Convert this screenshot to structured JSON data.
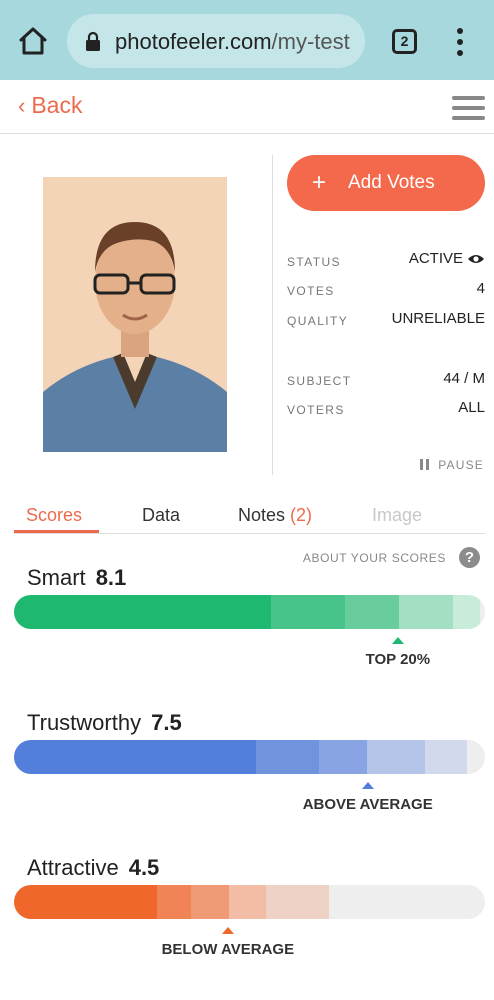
{
  "browser": {
    "url_main": "photofeeler.com",
    "url_path": "/my-test",
    "tab_count": "2"
  },
  "header": {
    "back_label": "Back"
  },
  "test": {
    "add_votes_label": "Add Votes",
    "info": [
      {
        "label": "STATUS",
        "value": "ACTIVE"
      },
      {
        "label": "VOTES",
        "value": "4"
      },
      {
        "label": "QUALITY",
        "value": "UNRELIABLE"
      },
      {
        "label": "SUBJECT",
        "value": "44 / M"
      },
      {
        "label": "VOTERS",
        "value": "ALL"
      }
    ],
    "pause_label": "PAUSE"
  },
  "tabs": [
    {
      "label": "Scores",
      "state": "active"
    },
    {
      "label": "Data",
      "state": "normal"
    },
    {
      "label": "Notes",
      "count": "(2)",
      "state": "normal"
    },
    {
      "label": "Image",
      "state": "disabled"
    }
  ],
  "about_scores_label": "ABOUT YOUR SCORES",
  "scores": [
    {
      "name": "Smart",
      "value": "8.1",
      "rank": "TOP 20%",
      "marker_fraction": 0.815,
      "colors": [
        "#1fb870",
        "#46c48a",
        "#68cc9d",
        "#a3e0c3",
        "#c9ecda"
      ],
      "stops": [
        0.546,
        0.703,
        0.818,
        0.933,
        0.99
      ]
    },
    {
      "name": "Trustworthy",
      "value": "7.5",
      "rank": "ABOVE AVERAGE",
      "marker_fraction": 0.751,
      "colors": [
        "#527fd9",
        "#6f93dd",
        "#88a4e2",
        "#b4c4e8",
        "#d2d9ec"
      ],
      "stops": [
        0.514,
        0.648,
        0.749,
        0.873,
        0.962
      ]
    },
    {
      "name": "Attractive",
      "value": "4.5",
      "rank": "BELOW AVERAGE",
      "marker_fraction": 0.454,
      "colors": [
        "#f0672b",
        "#f08456",
        "#f09a75",
        "#f2bca6",
        "#efd2c6"
      ],
      "stops": [
        0.304,
        0.376,
        0.456,
        0.535,
        0.668
      ]
    }
  ]
}
